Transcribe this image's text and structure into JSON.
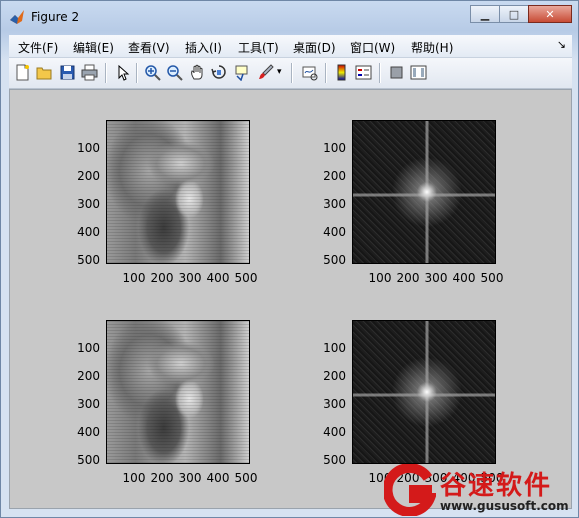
{
  "window": {
    "title": "Figure 2"
  },
  "menu": [
    {
      "label": "文件(F)"
    },
    {
      "label": "编辑(E)"
    },
    {
      "label": "查看(V)"
    },
    {
      "label": "插入(I)"
    },
    {
      "label": "工具(T)"
    },
    {
      "label": "桌面(D)"
    },
    {
      "label": "窗口(W)"
    },
    {
      "label": "帮助(H)"
    }
  ],
  "toolbar": {
    "icons": [
      "new-figure-icon",
      "open-file-icon",
      "save-icon",
      "print-icon",
      "pointer-icon",
      "zoom-in-icon",
      "zoom-out-icon",
      "pan-icon",
      "rotate-3d-icon",
      "data-cursor-icon",
      "brush-icon",
      "link-plot-icon",
      "colorbar-icon",
      "legend-icon",
      "hide-plot-tools-icon",
      "show-plot-tools-icon"
    ]
  },
  "axes": {
    "y_ticks": [
      "100",
      "200",
      "300",
      "400",
      "500"
    ],
    "x_ticks": [
      "100",
      "200",
      "300",
      "400",
      "500"
    ]
  },
  "subplots": [
    {
      "name": "original-image",
      "content": "image"
    },
    {
      "name": "original-spectrum",
      "content": "fft"
    },
    {
      "name": "filtered-image",
      "content": "image"
    },
    {
      "name": "filtered-spectrum",
      "content": "fft"
    }
  ],
  "watermark": {
    "text": "谷速软件",
    "url": "www.gususoft.com",
    "color": "#d41a1a"
  }
}
